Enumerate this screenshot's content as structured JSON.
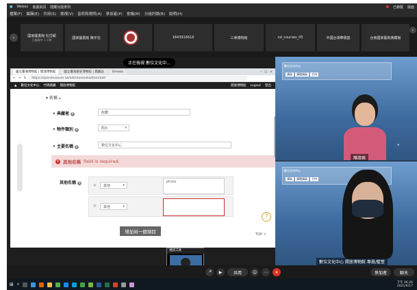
{
  "window": {
    "title": "Webex",
    "meeting_info": "會議資訊",
    "meeting_open": "隱藏功能表列"
  },
  "menu": [
    "檔案(F)",
    "編輯(E)",
    "共用(S)",
    "檢視(V)",
    "音訊和視訊(A)",
    "參加者(P)",
    "會議(M)",
    "分組討論(B)",
    "說明(H)"
  ],
  "recording_label": "已錄製",
  "layout_label": "版面",
  "participants_strip": [
    {
      "name": "國家圖書館 杜岱穎",
      "sub": "已錄製中 1 小時"
    },
    {
      "name": "國家圖書館 陳宇沈"
    },
    {
      "name": "seal"
    },
    {
      "name": "1843916616"
    },
    {
      "name": "三峽博物館"
    },
    {
      "name": "nd_courses_05"
    },
    {
      "name": "中國台灣華僑基"
    },
    {
      "name": "台南國家藝術典藏館"
    }
  ],
  "share_banner": "正在檢視 數位文化中...",
  "browser": {
    "tabs": [
      "國立臺灣博物館 | 開放博物館",
      "國立臺灣歷史博物館 | 典藏品",
      "Omeka"
    ],
    "url": "https://openmuseum.tw/admin/omeka/item/add",
    "nav": [
      "數位文化中心",
      "代碼典藏",
      "開放博物館"
    ],
    "right_nav": [
      "開放博物館",
      "Logout",
      "登出"
    ]
  },
  "form": {
    "section_title": "名稱",
    "owner_label": "典藏者",
    "owner_value": "館藏",
    "category_label": "物件類別",
    "category_value": "照片",
    "main_title_label": "主要名稱",
    "main_title_value": "數位文化中心",
    "error_field": "其他名稱",
    "error_message": "field is required.",
    "other_names_label": "其他名稱",
    "row1_select": "其他",
    "row1_text": "photo",
    "row2_select": "其他",
    "row2_text": "",
    "add_button": "增加另一個項目",
    "help_button": "?",
    "to_top": "TOP ⇧"
  },
  "cameras": [
    {
      "name": "陳淑君",
      "banner": "數位文化中心"
    },
    {
      "name": "數位文化中心 開放博物館 專員/籃萱",
      "banner": "數位文化中心"
    }
  ],
  "banner_buttons": [
    "講員",
    "講題講員",
    "主持"
  ],
  "controls": {
    "share_button": "共用",
    "participants_button": "參加者",
    "chat_button": "聊天"
  },
  "selfview_title": "視訊工具",
  "taskbar": {
    "time": "下午 06:26",
    "date": "2021/6/17"
  },
  "colors": {
    "error_bg": "#f4d9d9",
    "error_text": "#b94a48",
    "hangup": "#d93025",
    "camera_bg": "#5a86b8"
  }
}
